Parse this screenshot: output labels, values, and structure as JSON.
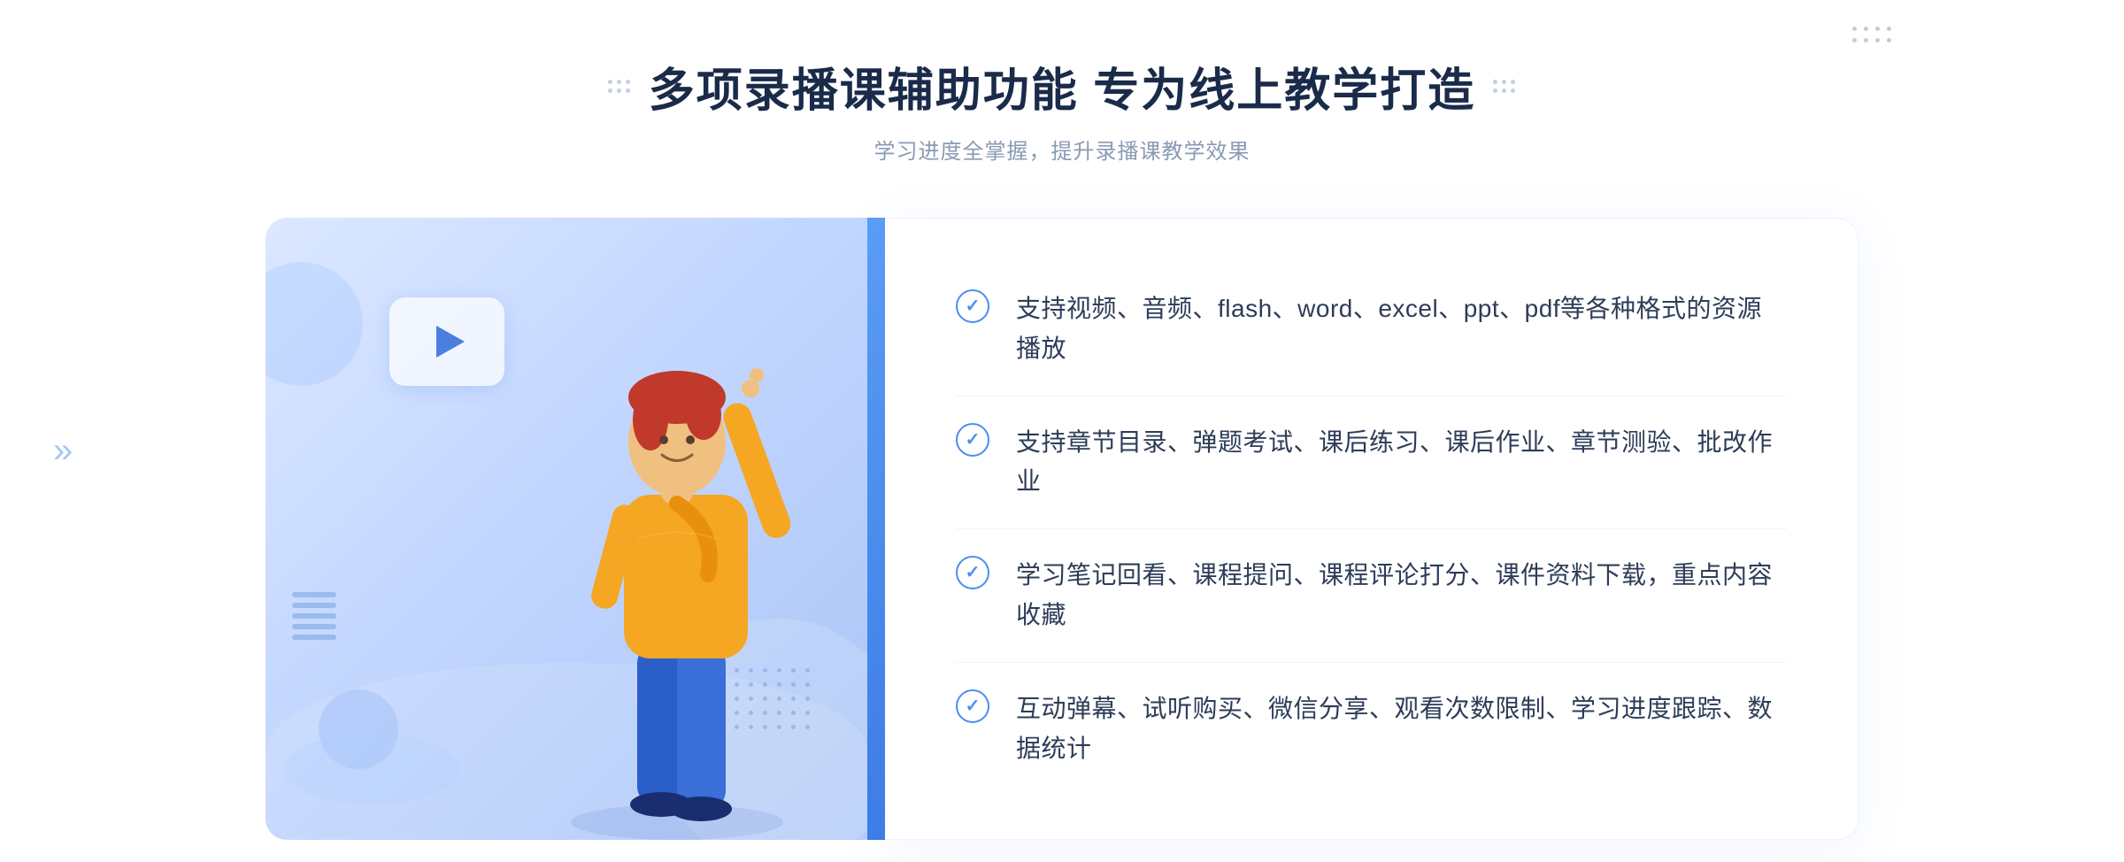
{
  "header": {
    "title": "多项录播课辅助功能 专为线上教学打造",
    "subtitle": "学习进度全掌握，提升录播课教学效果"
  },
  "features": [
    {
      "id": 1,
      "text": "支持视频、音频、flash、word、excel、ppt、pdf等各种格式的资源播放"
    },
    {
      "id": 2,
      "text": "支持章节目录、弹题考试、课后练习、课后作业、章节测验、批改作业"
    },
    {
      "id": 3,
      "text": "学习笔记回看、课程提问、课程评论打分、课件资料下载，重点内容收藏"
    },
    {
      "id": 4,
      "text": "互动弹幕、试听购买、微信分享、观看次数限制、学习进度跟踪、数据统计"
    }
  ],
  "decorations": {
    "left_chevron": "»",
    "check_symbol": "✓"
  }
}
